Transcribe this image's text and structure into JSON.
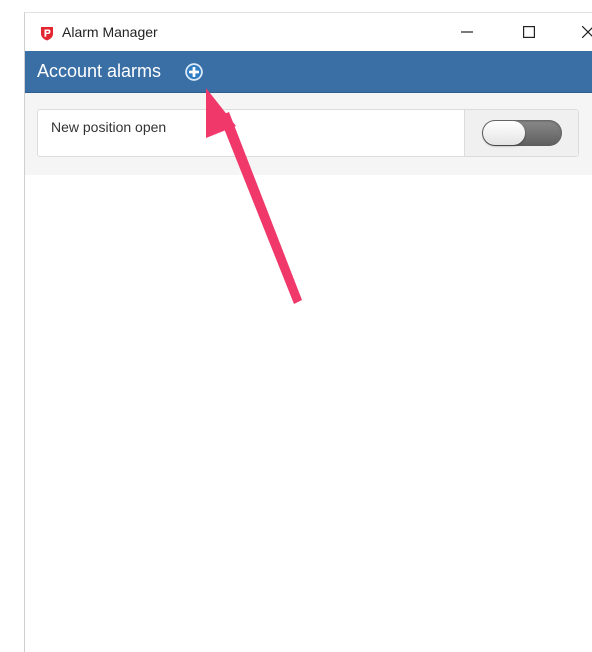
{
  "window": {
    "title": "Alarm Manager",
    "app_icon": "app-logo-icon",
    "controls": {
      "minimize_icon": "minimize-icon",
      "maximize_icon": "maximize-icon",
      "close_icon": "close-icon"
    }
  },
  "header": {
    "title": "Account alarms",
    "add_icon": "plus-circle-icon"
  },
  "alarms": [
    {
      "label": "New position open",
      "enabled": false
    }
  ],
  "colors": {
    "header_bg": "#3a6fa5",
    "annotation_arrow": "#f0386b",
    "logo_red": "#e3262f"
  }
}
